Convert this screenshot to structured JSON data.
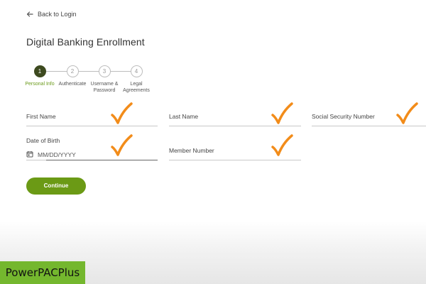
{
  "header": {
    "back_label": "Back to Login",
    "title": "Digital Banking Enrollment"
  },
  "stepper": {
    "steps": [
      {
        "number": "1",
        "label": "Personal Info",
        "state": "active"
      },
      {
        "number": "2",
        "label": "Authenticate",
        "state": "pending"
      },
      {
        "number": "3",
        "label": "Username & Password",
        "state": "pending"
      },
      {
        "number": "4",
        "label": "Legal Agreements",
        "state": "pending"
      }
    ]
  },
  "form": {
    "first_name": {
      "label": "First Name",
      "value": ""
    },
    "last_name": {
      "label": "Last Name",
      "value": ""
    },
    "ssn": {
      "label": "Social Security Number",
      "value": ""
    },
    "dob": {
      "label": "Date of Birth",
      "placeholder": "MM/DD/YYYY",
      "icon": "calendar-icon"
    },
    "member_number": {
      "label": "Member Number",
      "value": ""
    }
  },
  "actions": {
    "continue_label": "Continue"
  },
  "watermark": {
    "text": "PowerPACPlus"
  },
  "colors": {
    "accent": "#6b9a15",
    "active_step": "#3d4a1f",
    "checkmark": "#f28c1a",
    "watermark_bg": "#74b72e"
  }
}
